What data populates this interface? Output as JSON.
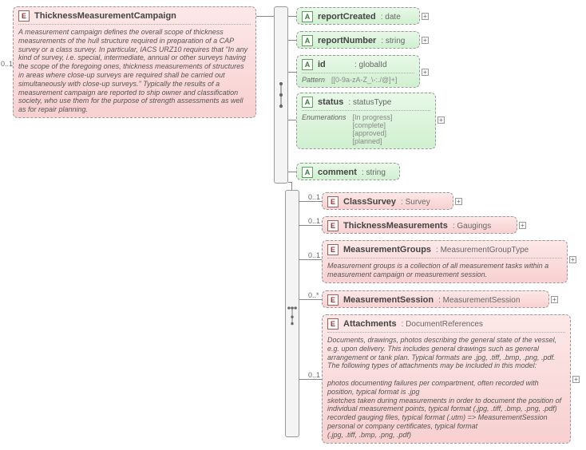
{
  "root": {
    "name": "ThicknessMeasurementCampaign",
    "desc": "A measurement campaign defines the overall scope of thickness measurements of the hull structure required in preparation of a CAP survey or a class survey. In particular, IACS URZ10 requires that \"In any kind of survey, i.e. special, intermediate, annual or other surveys having the scope of the foregoing ones, thickness measurements of structures in areas where close-up surveys are required shall be carried out simultaneously with close-up surveys.\" Typically the results of a measurement campaign are reported to ship owner and classification society, who use them for the purpose of strength assessments as well as for repair planning.",
    "card": "0..1"
  },
  "attrs": {
    "reportCreated": {
      "name": "reportCreated",
      "type": ": date"
    },
    "reportNumber": {
      "name": "reportNumber",
      "type": ": string"
    },
    "id": {
      "name": "id",
      "type": ": globalId",
      "patternLabel": "Pattern",
      "patternVal": "[[0-9a-zA-Z_\\-:./@]+]"
    },
    "status": {
      "name": "status",
      "type": ": statusType",
      "enumLabel": "Enumerations",
      "enumVals": "[In progress]\n[complete]\n[approved]\n[planned]"
    },
    "comment": {
      "name": "comment",
      "type": ": string"
    }
  },
  "children": {
    "classSurvey": {
      "name": "ClassSurvey",
      "type": ": Survey",
      "card": "0..1"
    },
    "thickMeas": {
      "name": "ThicknessMeasurements",
      "type": ": Gaugings",
      "card": "0..1"
    },
    "measGroups": {
      "name": "MeasurementGroups",
      "type": ": MeasurementGroupType",
      "card": "0..1",
      "desc": "Measurement groups is a collection of all measurement tasks within a measurement campaign or measurement session."
    },
    "measSession": {
      "name": "MeasurementSession",
      "type": ": MeasurementSession",
      "card": "0..*"
    },
    "attach": {
      "name": "Attachments",
      "type": ": DocumentReferences",
      "card": "0..1",
      "desc": "Documents, drawings, photos describing the general state of the vessel, e.g. upon delivery. This includes general drawings such as general arrangement or tank plan. Typical formats are .jpg, .tiff, .bmp, .png, .pdf. The following types of attachments may be included in this model:\n\n   photos documenting failures per compartment, often recorded with position, typical format is .jpg\n   sketches taken during measurements in order to document the position of individual measurement points, typical format (.jpg, .tiff, .bmp, .png, .pdf)\n   recorded gauging files, typical format (.utm) => MeasurementSession\n   personal or company certificates, typical format\n(.jpg, .tiff, .bmp, .png, .pdf)"
    }
  }
}
